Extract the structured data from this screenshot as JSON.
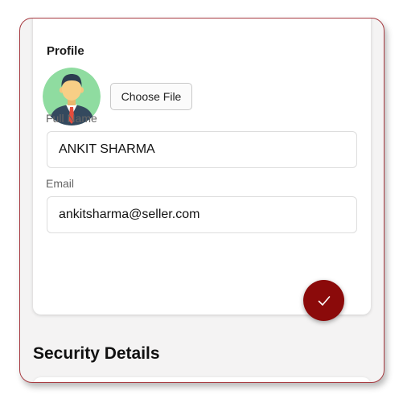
{
  "profile": {
    "section_label": "Profile",
    "choose_file_label": "Choose File",
    "full_name": {
      "label": "Full Name",
      "value": "ANKIT SHARMA"
    },
    "email": {
      "label": "Email",
      "value": "ankitsharma@seller.com"
    },
    "submit_icon": "checkmark-icon",
    "avatar_icon": "businessman-avatar-icon"
  },
  "security": {
    "title": "Security Details"
  },
  "colors": {
    "accent": "#8b0a0a",
    "frame_border": "#a83c42",
    "avatar_background": "#8fdca0"
  }
}
